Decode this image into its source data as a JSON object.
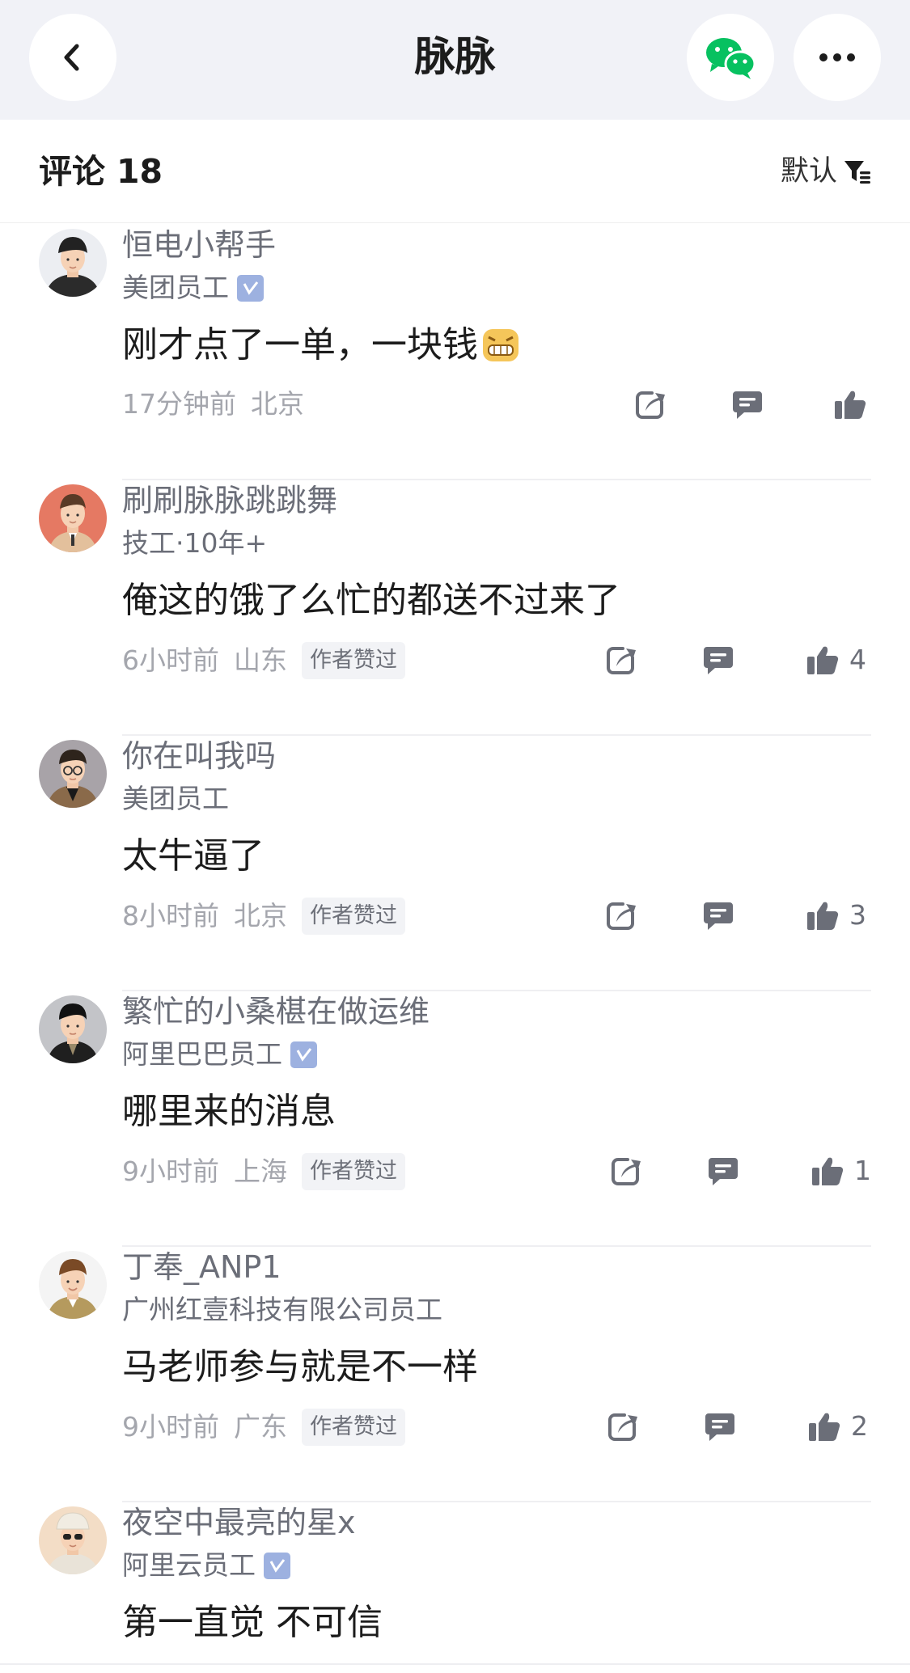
{
  "header": {
    "title": "脉脉"
  },
  "comments_header": {
    "label": "评论",
    "count": "18",
    "sort_label": "默认"
  },
  "comments": [
    {
      "name": "恒电小帮手",
      "role": "美团员工",
      "verified": true,
      "content": "刚才点了一单，一块钱",
      "emoji": "grinning-emoji",
      "time": "17分钟前",
      "location": "北京",
      "author_liked": "",
      "likes": ""
    },
    {
      "name": "刷刷脉脉跳跳舞",
      "role": "技工·10年+",
      "verified": false,
      "content": "俺这的饿了么忙的都送不过来了",
      "time": "6小时前",
      "location": "山东",
      "author_liked": "作者赞过",
      "likes": "4"
    },
    {
      "name": "你在叫我吗",
      "role": "美团员工",
      "verified": false,
      "content": "太牛逼了",
      "time": "8小时前",
      "location": "北京",
      "author_liked": "作者赞过",
      "likes": "3"
    },
    {
      "name": "繁忙的小桑椹在做运维",
      "role": "阿里巴巴员工",
      "verified": true,
      "content": "哪里来的消息",
      "time": "9小时前",
      "location": "上海",
      "author_liked": "作者赞过",
      "likes": "1"
    },
    {
      "name": "丁奉_ANP1",
      "role": "广州红壹科技有限公司员工",
      "verified": false,
      "content": "马老师参与就是不一样",
      "time": "9小时前",
      "location": "广东",
      "author_liked": "作者赞过",
      "likes": "2"
    },
    {
      "name": "夜空中最亮的星x",
      "role": "阿里云员工",
      "verified": true,
      "content": "第一直觉 不可信",
      "time": "",
      "location": "",
      "author_liked": "",
      "likes": ""
    }
  ],
  "colors": {
    "wechat_green": "#07c160",
    "verified_badge": "#9db1e0",
    "topbar_bg": "#f1f2f7"
  }
}
